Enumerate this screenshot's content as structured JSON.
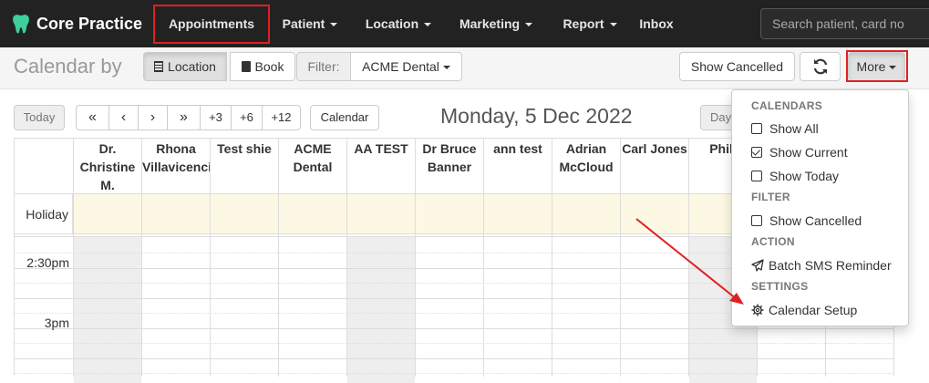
{
  "brand": {
    "name": "Core Practice"
  },
  "nav": {
    "items": [
      {
        "label": "Appointments",
        "dropdown": false
      },
      {
        "label": "Patient",
        "dropdown": true
      },
      {
        "label": "Location",
        "dropdown": true
      },
      {
        "label": "Marketing",
        "dropdown": true
      },
      {
        "label": "Report",
        "dropdown": true
      },
      {
        "label": "Inbox",
        "dropdown": false
      }
    ],
    "search_placeholder": "Search patient, card no"
  },
  "toolbar": {
    "title": "Calendar by",
    "location_label": "Location",
    "book_label": "Book",
    "filter_label": "Filter:",
    "filter_value": "ACME Dental",
    "show_cancelled": "Show Cancelled",
    "more_label": "More"
  },
  "datenav": {
    "today": "Today",
    "first": "«",
    "prev": "‹",
    "next": "›",
    "last": "»",
    "p3": "+3",
    "p6": "+6",
    "p12": "+12",
    "calendar": "Calendar",
    "date_title": "Monday, 5 Dec 2022",
    "day_view": "Day"
  },
  "calendar": {
    "columns": [
      "Dr. Christine M.",
      "Rhona Villavicencio",
      "Test shie",
      "ACME Dental",
      "AA TEST",
      "Dr Bruce Banner",
      "ann test",
      "Adrian McCloud",
      "Carl Jones",
      "Phili",
      "",
      ""
    ],
    "holiday_label": "Holiday",
    "times": [
      "2:30pm",
      "3pm"
    ]
  },
  "more_menu": {
    "calendars_header": "CALENDARS",
    "show_all": "Show All",
    "show_current": "Show Current",
    "show_today": "Show Today",
    "filter_header": "FILTER",
    "show_cancelled": "Show Cancelled",
    "action_header": "ACTION",
    "batch_sms": "Batch SMS Reminder",
    "settings_header": "SETTINGS",
    "calendar_setup": "Calendar Setup",
    "checked": {
      "show_all": false,
      "show_current": true,
      "show_today": false,
      "show_cancelled": false
    }
  },
  "colors": {
    "annotation": "#e02020",
    "navbar": "#222222",
    "holiday": "#fcf8e3"
  }
}
